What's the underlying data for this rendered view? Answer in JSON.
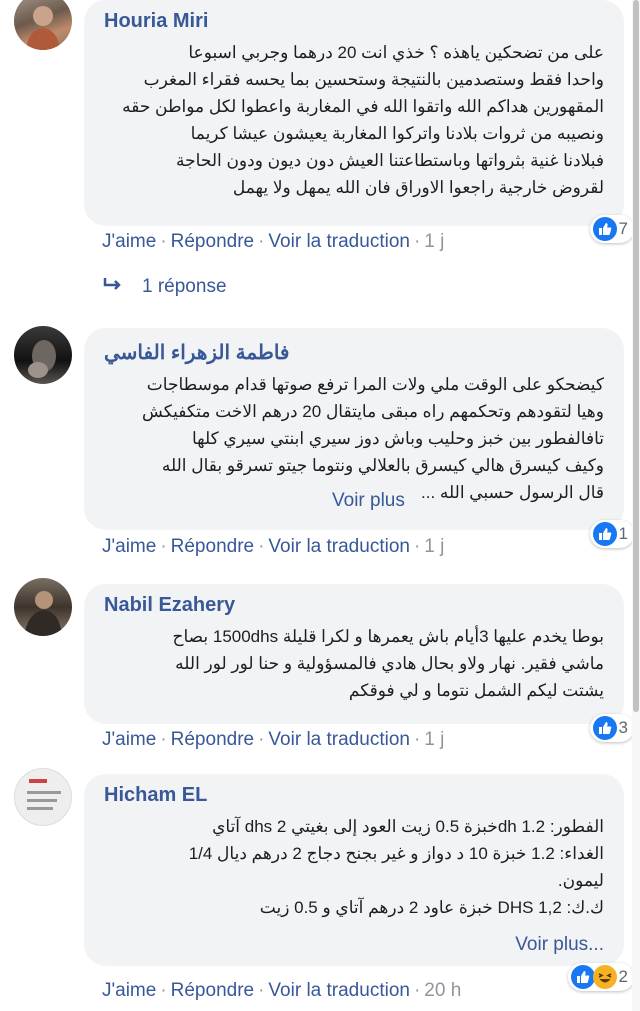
{
  "comments": [
    {
      "author": "Houria Miri",
      "text": "على من تضحكين ياهذه ؟ خذي انت 20 درهما وجربي اسبوعا\nواحدا فقط وستصدمين بالنتيجة وستحسين بما يحسه فقراء المغرب\nالمقهورين هداكم الله واتقوا الله في المغاربة واعطوا لكل مواطن حقه\nونصيبه من ثروات بلادنا واتركوا المغاربة يعيشون عيشا كريما\nفبلادنا غنية بثرواتها وباستطاعتنا العيش دون ديون ودون الحاجة\nلقروض خارجية راجعوا الاوراق فان الله يمهل ولا يهمل",
      "see_more": "",
      "like": "J'aime",
      "reply": "Répondre",
      "translate": "Voir la traduction",
      "time": "1 j",
      "reaction_count": "7",
      "replies_label": "1 réponse"
    },
    {
      "author": "فاطمة الزهراء الفاسي",
      "text": "كيضحكو على الوقت ملي ولات المرا ترفع صوتها قدام موسطاجات\nوهيا لتقودهم وتحكمهم راه مبقى مايتقال 20 درهم الاخت متكفيكش\nتافالفطور بين خبز وحليب وباش دوز سيري ابنتي سيري كلها\nوكيف كيسرق هالي كيسرق بالعلالي ونتوما جيتو تسرقو بقال الله\nقال الرسول حسبي الله ...",
      "see_more": "Voir plus",
      "like": "J'aime",
      "reply": "Répondre",
      "translate": "Voir la traduction",
      "time": "1 j",
      "reaction_count": "1"
    },
    {
      "author": "Nabil Ezahery",
      "text": "بوطا يخدم عليها 3أيام باش يعمرها و لكرا قليلة 1500dhs بصاح\nماشي فقير. نهار ولاو بحال هادي فالمسؤولية و حنا لور لور الله\nيشتت ليكم الشمل نتوما و لي فوقكم",
      "see_more": "",
      "like": "J'aime",
      "reply": "Répondre",
      "translate": "Voir la traduction",
      "time": "1 j",
      "reaction_count": "3"
    },
    {
      "author": "Hicham EL",
      "text": "الفطور: 1.2 dhخبزة 0.5 زيت العود إلى بغيتي 2 dhs آتاي\nالغداء: 1.2 خبزة 10 د دواز و غير بجنح دجاج 2 درهم ديال 1/4\nليمون.\nك.ك: DHS 1,2 خبزة عاود 2 درهم آتاي و 0.5 زيت",
      "see_more": "Voir plus...",
      "like": "J'aime",
      "reply": "Répondre",
      "translate": "Voir la traduction",
      "time": "20 h",
      "reaction_count": "2"
    }
  ],
  "icons": {
    "like": "thumbs-up-icon",
    "haha": "laughing-face-icon",
    "reply_arrow": "reply-arrow-icon"
  },
  "colors": {
    "link": "#385898",
    "like_blue": "#1877f2",
    "bubble_bg": "#f2f3f5",
    "meta_gray": "#90949c"
  }
}
